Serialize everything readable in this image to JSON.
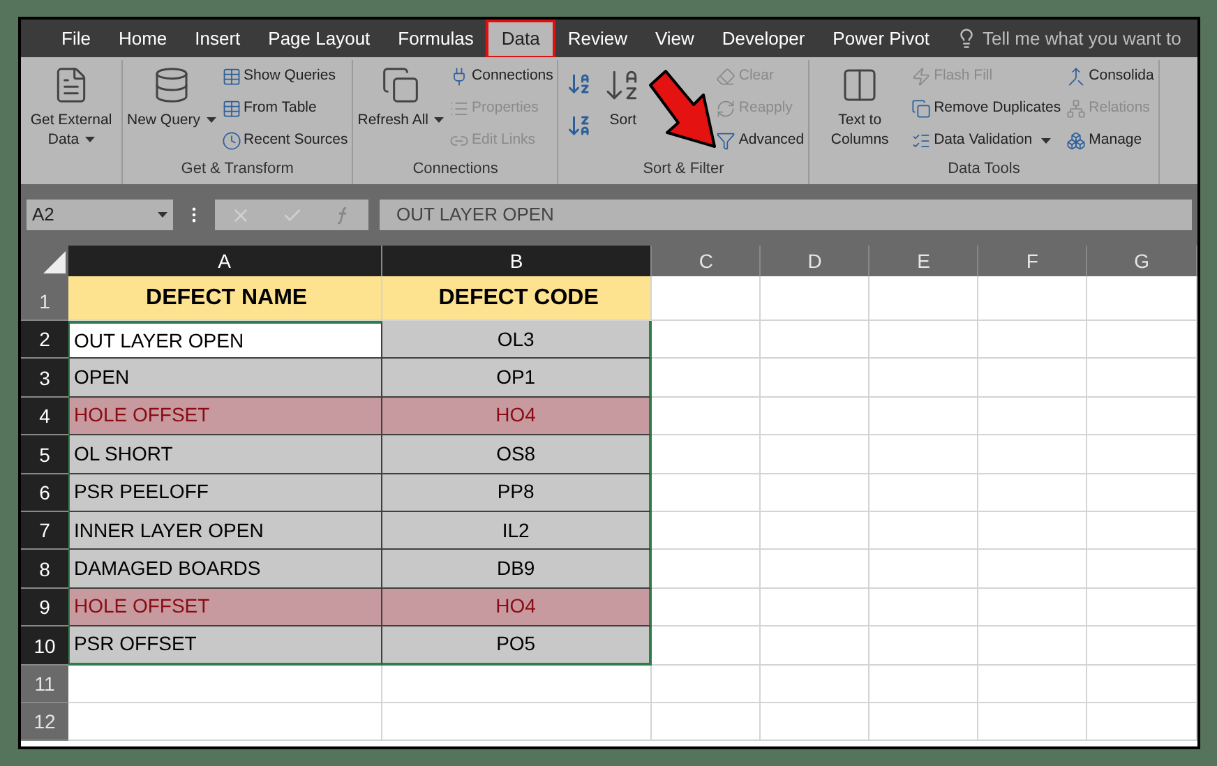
{
  "tabs": [
    {
      "label": "File",
      "selected": false
    },
    {
      "label": "Home",
      "selected": false
    },
    {
      "label": "Insert",
      "selected": false
    },
    {
      "label": "Page Layout",
      "selected": false
    },
    {
      "label": "Formulas",
      "selected": false
    },
    {
      "label": "Data",
      "selected": true
    },
    {
      "label": "Review",
      "selected": false
    },
    {
      "label": "View",
      "selected": false
    },
    {
      "label": "Developer",
      "selected": false
    },
    {
      "label": "Power Pivot",
      "selected": false
    }
  ],
  "tell_me": {
    "placeholder": "Tell me what you want to"
  },
  "ribbon": {
    "groups": [
      {
        "items": [
          {
            "kind": "large",
            "label": "Get External Data",
            "dropdown": true,
            "disabled": false
          }
        ]
      },
      {
        "label": "Get & Transform",
        "items": [
          {
            "kind": "large",
            "label": "New Query",
            "dropdown": true,
            "disabled": false
          },
          {
            "kind": "small",
            "label": "Show Queries",
            "dropdown": false,
            "disabled": false
          },
          {
            "kind": "small",
            "label": "From Table",
            "dropdown": false,
            "disabled": false
          },
          {
            "kind": "small",
            "label": "Recent Sources",
            "dropdown": false,
            "disabled": false
          }
        ]
      },
      {
        "label": "Connections",
        "items": [
          {
            "kind": "large",
            "label": "Refresh All",
            "dropdown": true,
            "disabled": false
          },
          {
            "kind": "small",
            "label": "Connections",
            "dropdown": false,
            "disabled": false
          },
          {
            "kind": "small",
            "label": "Properties",
            "dropdown": false,
            "disabled": true
          },
          {
            "kind": "small",
            "label": "Edit Links",
            "dropdown": false,
            "disabled": true
          }
        ]
      },
      {
        "label": "Sort & Filter",
        "items": [
          {
            "kind": "sort-pair"
          },
          {
            "kind": "large",
            "label": "Sort",
            "dropdown": false,
            "disabled": false
          },
          {
            "kind": "covered"
          },
          {
            "kind": "small",
            "label": "Clear",
            "dropdown": false,
            "disabled": true
          },
          {
            "kind": "small",
            "label": "Reapply",
            "dropdown": false,
            "disabled": true
          },
          {
            "kind": "small",
            "label": "Advanced",
            "dropdown": false,
            "disabled": false
          }
        ]
      },
      {
        "label": "Data Tools",
        "items": [
          {
            "kind": "large",
            "label": "Text to Columns",
            "dropdown": false,
            "disabled": false
          },
          {
            "kind": "small",
            "label": "Flash Fill",
            "dropdown": false,
            "disabled": true
          },
          {
            "kind": "small",
            "label": "Remove Duplicates",
            "dropdown": false,
            "disabled": false
          },
          {
            "kind": "small",
            "label": "Data Validation",
            "dropdown": true,
            "disabled": false
          },
          {
            "kind": "small",
            "label": "Consolida",
            "dropdown": false,
            "disabled": false
          },
          {
            "kind": "small",
            "label": "Relations",
            "dropdown": false,
            "disabled": true
          },
          {
            "kind": "small",
            "label": "Manage",
            "dropdown": false,
            "disabled": false
          }
        ]
      }
    ]
  },
  "formula_bar": {
    "name_box": "A2",
    "formula": "OUT LAYER OPEN"
  },
  "sheet": {
    "columns": [
      "A",
      "B",
      "C",
      "D",
      "E",
      "F",
      "G"
    ],
    "rows": [
      {
        "number": "1",
        "a": "DEFECT NAME",
        "b": "DEFECT CODE",
        "kind": "header",
        "selected": false,
        "active": false,
        "highlighted": false
      },
      {
        "number": "2",
        "a": "OUT LAYER OPEN",
        "b": "OL3",
        "kind": "data",
        "selected": true,
        "active": true,
        "highlighted": false
      },
      {
        "number": "3",
        "a": "OPEN",
        "b": "OP1",
        "kind": "data",
        "selected": true,
        "active": false,
        "highlighted": false
      },
      {
        "number": "4",
        "a": "HOLE OFFSET",
        "b": "HO4",
        "kind": "data",
        "selected": true,
        "active": false,
        "highlighted": true
      },
      {
        "number": "5",
        "a": "OL SHORT",
        "b": "OS8",
        "kind": "data",
        "selected": true,
        "active": false,
        "highlighted": false
      },
      {
        "number": "6",
        "a": "PSR PEELOFF",
        "b": "PP8",
        "kind": "data",
        "selected": true,
        "active": false,
        "highlighted": false
      },
      {
        "number": "7",
        "a": "INNER LAYER OPEN",
        "b": "IL2",
        "kind": "data",
        "selected": true,
        "active": false,
        "highlighted": false
      },
      {
        "number": "8",
        "a": "DAMAGED BOARDS",
        "b": "DB9",
        "kind": "data",
        "selected": true,
        "active": false,
        "highlighted": false
      },
      {
        "number": "9",
        "a": "HOLE OFFSET",
        "b": "HO4",
        "kind": "data",
        "selected": true,
        "active": false,
        "highlighted": true
      },
      {
        "number": "10",
        "a": "PSR OFFSET",
        "b": "PO5",
        "kind": "data",
        "selected": true,
        "active": false,
        "highlighted": false
      },
      {
        "number": "11",
        "kind": "data",
        "selected": false,
        "active": false,
        "highlighted": false
      },
      {
        "number": "12",
        "kind": "data",
        "selected": false,
        "active": false,
        "highlighted": false
      }
    ]
  }
}
